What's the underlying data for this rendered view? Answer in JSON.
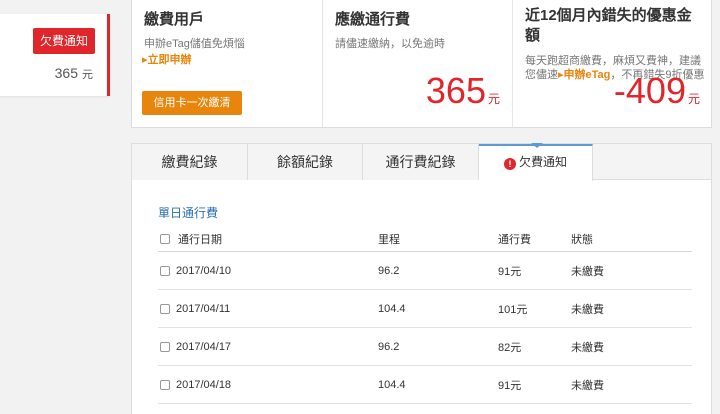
{
  "sidebar": {
    "badge": "欠費通知",
    "amount": "365",
    "unit": "元"
  },
  "summary": {
    "col1": {
      "title": "繳費用戶",
      "desc": "申辦eTag儲值免煩惱",
      "link": "▸立即申辦",
      "button": "信用卡一次繳清"
    },
    "col2": {
      "title": "應繳通行費",
      "desc": "請儘速繳納，以免逾時",
      "amount": "365",
      "unit": "元"
    },
    "col3": {
      "title": "近12個月內錯失的優惠金額",
      "desc_a": "每天跑超商繳費，麻煩又費神，建議您儘速",
      "desc_hl": "▸申辦eTag",
      "desc_b": "，不再錯失9折優惠",
      "amount": "-409",
      "unit": "元"
    }
  },
  "tabs": [
    {
      "label": "繳費紀錄"
    },
    {
      "label": "餘額紀錄"
    },
    {
      "label": "通行費紀錄"
    },
    {
      "label": "欠費通知",
      "icon": "alert-icon",
      "active": true
    }
  ],
  "section_title": "單日通行費",
  "table": {
    "headers": [
      "通行日期",
      "里程",
      "通行費",
      "狀態"
    ],
    "rows": [
      {
        "date": "2017/04/10",
        "km": "96.2",
        "fee": "91元",
        "status": "未繳費"
      },
      {
        "date": "2017/04/11",
        "km": "104.4",
        "fee": "101元",
        "status": "未繳費"
      },
      {
        "date": "2017/04/17",
        "km": "96.2",
        "fee": "82元",
        "status": "未繳費"
      },
      {
        "date": "2017/04/18",
        "km": "104.4",
        "fee": "91元",
        "status": "未繳費"
      }
    ]
  },
  "colors": {
    "accent_red": "#e0252b",
    "accent_orange": "#e8850c",
    "link_blue": "#2a6fb0"
  }
}
